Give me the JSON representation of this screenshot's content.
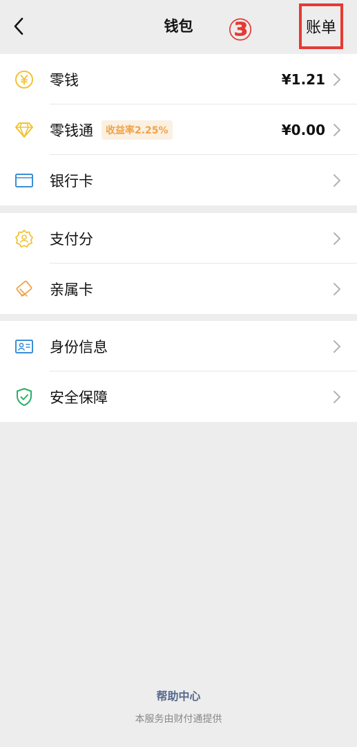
{
  "header": {
    "title": "钱包",
    "step_marker": "③",
    "bill_label": "账单"
  },
  "groups": [
    {
      "items": [
        {
          "label": "零钱",
          "value": "¥1.21",
          "icon": "yuan-coin-icon",
          "icon_color": "#f2c233"
        },
        {
          "label": "零钱通",
          "tag": "收益率2.25%",
          "value": "¥0.00",
          "icon": "diamond-icon",
          "icon_color": "#f2c233"
        },
        {
          "label": "银行卡",
          "icon": "bank-card-icon",
          "icon_color": "#3a8ed8"
        }
      ]
    },
    {
      "items": [
        {
          "label": "支付分",
          "icon": "pay-score-icon",
          "icon_color": "#f2c233"
        },
        {
          "label": "亲属卡",
          "icon": "family-card-icon",
          "icon_color": "#f0a347"
        }
      ]
    },
    {
      "items": [
        {
          "label": "身份信息",
          "icon": "id-card-icon",
          "icon_color": "#3a8ed8"
        },
        {
          "label": "安全保障",
          "icon": "shield-check-icon",
          "icon_color": "#2aae67"
        }
      ]
    }
  ],
  "footer": {
    "help_label": "帮助中心",
    "note": "本服务由财付通提供"
  },
  "colors": {
    "background": "#ededed",
    "highlight_red": "#e53a33",
    "link_blue": "#55698e"
  }
}
